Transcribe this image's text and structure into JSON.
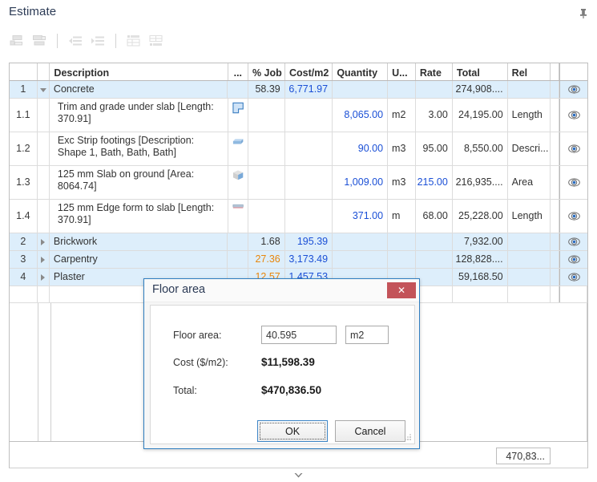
{
  "panel": {
    "title": "Estimate",
    "pin_icon": "pin-icon",
    "collapse_icon": "chevron-down-icon"
  },
  "toolbar": {
    "buttons": [
      {
        "name": "add-sibling-item-button",
        "icon": "add-row-above-icon"
      },
      {
        "name": "add-child-item-button",
        "icon": "add-row-below-icon"
      },
      {
        "name": "outdent-button",
        "icon": "outdent-icon"
      },
      {
        "name": "indent-button",
        "icon": "indent-icon"
      },
      {
        "name": "insert-row-button",
        "icon": "insert-row-icon"
      },
      {
        "name": "delete-row-button",
        "icon": "delete-row-icon"
      }
    ]
  },
  "grid": {
    "columns": [
      {
        "key": "index",
        "label": ""
      },
      {
        "key": "tree",
        "label": ""
      },
      {
        "key": "desc",
        "label": "Description"
      },
      {
        "key": "shape",
        "label": "..."
      },
      {
        "key": "pct_job",
        "label": "% Job"
      },
      {
        "key": "cost_m2",
        "label": "Cost/m2"
      },
      {
        "key": "quantity",
        "label": "Quantity"
      },
      {
        "key": "unit",
        "label": "U..."
      },
      {
        "key": "rate",
        "label": "Rate"
      },
      {
        "key": "total",
        "label": "Total"
      },
      {
        "key": "rel",
        "label": "Rel"
      },
      {
        "key": "visible",
        "label": ""
      }
    ],
    "rows": [
      {
        "index": "1",
        "level": "group",
        "expander": "collapse",
        "desc": "Concrete",
        "shape": "",
        "pct_job": "58.39",
        "cost_m2": "6,771.97",
        "quantity": "",
        "unit": "",
        "rate": "",
        "total": "274,908....",
        "rel": "",
        "visible_icon": "eye-icon",
        "pct_color": "normal",
        "cost_color": "blue"
      },
      {
        "index": "1.1",
        "level": "child",
        "expander": "none",
        "desc": "Trim and grade under slab [Length: 370.91]",
        "shape": "polygon-shape-icon",
        "pct_job": "",
        "cost_m2": "",
        "quantity": "8,065.00",
        "unit": "m2",
        "rate": "3.00",
        "total": "24,195.00",
        "rel": "Length",
        "visible_icon": "eye-icon",
        "qty_color": "blue",
        "rate_color": "normal"
      },
      {
        "index": "1.2",
        "level": "child",
        "expander": "none",
        "desc": "Exc Strip footings [Description: Shape 1, Bath, Bath, Bath]",
        "shape": "prism-shape-icon",
        "pct_job": "",
        "cost_m2": "",
        "quantity": "90.00",
        "unit": "m3",
        "rate": "95.00",
        "total": "8,550.00",
        "rel": "Descri...",
        "visible_icon": "eye-icon",
        "qty_color": "blue",
        "rate_color": "normal"
      },
      {
        "index": "1.3",
        "level": "child",
        "expander": "none",
        "desc": "125 mm Slab on ground [Area: 8064.74]",
        "shape": "cube-shape-icon",
        "pct_job": "",
        "cost_m2": "",
        "quantity": "1,009.00",
        "unit": "m3",
        "rate": "215.00",
        "total": "216,935....",
        "rel": "Area",
        "visible_icon": "eye-icon",
        "qty_color": "blue",
        "rate_color": "blue"
      },
      {
        "index": "1.4",
        "level": "child",
        "expander": "none",
        "desc": "125 mm Edge form to slab [Length: 370.91]",
        "shape": "bar-shape-icon",
        "pct_job": "",
        "cost_m2": "",
        "quantity": "371.00",
        "unit": "m",
        "rate": "68.00",
        "total": "25,228.00",
        "rel": "Length",
        "visible_icon": "eye-icon",
        "qty_color": "blue",
        "rate_color": "normal"
      },
      {
        "index": "2",
        "level": "group",
        "expander": "expand",
        "desc": "Brickwork",
        "shape": "",
        "pct_job": "1.68",
        "cost_m2": "195.39",
        "quantity": "",
        "unit": "",
        "rate": "",
        "total": "7,932.00",
        "rel": "",
        "visible_icon": "eye-icon",
        "pct_color": "normal",
        "cost_color": "blue"
      },
      {
        "index": "3",
        "level": "group",
        "expander": "expand",
        "desc": "Carpentry",
        "shape": "",
        "pct_job": "27.36",
        "cost_m2": "3,173.49",
        "quantity": "",
        "unit": "",
        "rate": "",
        "total": "128,828....",
        "rel": "",
        "visible_icon": "eye-icon",
        "pct_color": "orange",
        "cost_color": "blue"
      },
      {
        "index": "4",
        "level": "group",
        "expander": "expand",
        "desc": "Plaster",
        "shape": "",
        "pct_job": "12.57",
        "cost_m2": "1,457.53",
        "quantity": "",
        "unit": "",
        "rate": "",
        "total": "59,168.50",
        "rel": "",
        "visible_icon": "eye-icon",
        "pct_color": "orange",
        "cost_color": "blue"
      }
    ]
  },
  "footer": {
    "total_value": "470,83..."
  },
  "dialog": {
    "title": "Floor area",
    "close_label": "✕",
    "close_icon": "close-icon",
    "fields": {
      "floor_area_label": "Floor area:",
      "floor_area_value": "40.595",
      "floor_area_unit": "m2",
      "cost_label": "Cost ($/m2):",
      "cost_value": "$11,598.39",
      "total_label": "Total:",
      "total_value": "$470,836.50"
    },
    "buttons": {
      "ok": "OK",
      "cancel": "Cancel"
    }
  },
  "colors": {
    "accent_blue": "#1a4fd6",
    "warn_orange": "#e8860c",
    "group_row_bg": "#ddeefb",
    "dialog_border": "#2f7ec0",
    "close_red": "#c35359"
  }
}
